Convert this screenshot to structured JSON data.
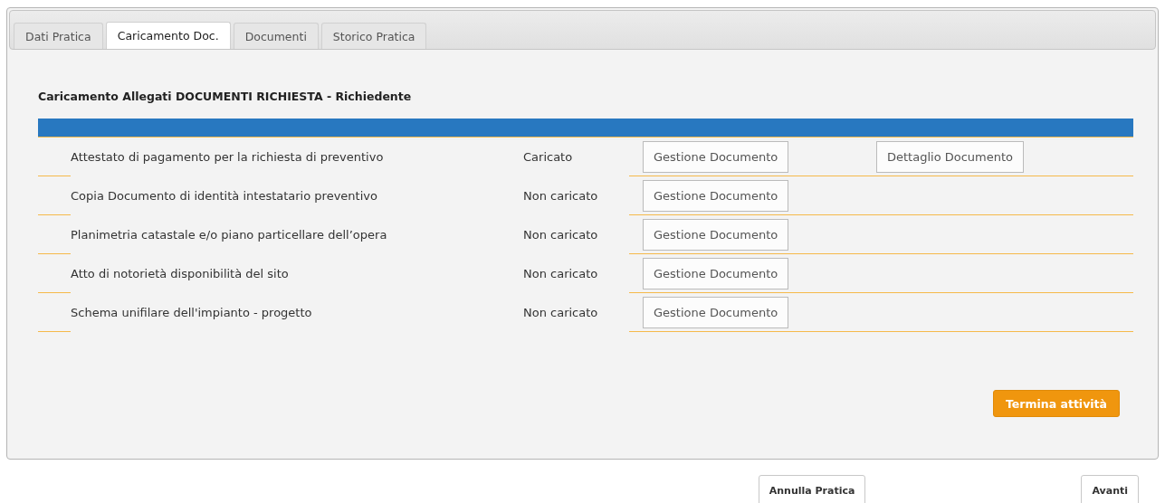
{
  "tabs": [
    {
      "label": "Dati Pratica",
      "selected": false
    },
    {
      "label": "Caricamento Doc.",
      "selected": true
    },
    {
      "label": "Documenti",
      "selected": false
    },
    {
      "label": "Storico Pratica",
      "selected": false
    }
  ],
  "section_title": "Caricamento Allegati DOCUMENTI RICHIESTA - Richiedente",
  "documents": [
    {
      "name": "Attestato di pagamento per la richiesta di preventivo",
      "status": "Caricato",
      "actions": [
        "Gestione Documento",
        "Dettaglio Documento"
      ]
    },
    {
      "name": "Copia Documento di identità intestatario preventivo",
      "status": "Non caricato",
      "actions": [
        "Gestione Documento"
      ]
    },
    {
      "name": "Planimetria catastale e/o piano particellare dell’opera",
      "status": "Non caricato",
      "actions": [
        "Gestione Documento"
      ]
    },
    {
      "name": "Atto di notorietà disponibilità del sito",
      "status": "Non caricato",
      "actions": [
        "Gestione Documento"
      ]
    },
    {
      "name": "Schema unifilare dell'impianto - progetto",
      "status": "Non caricato",
      "actions": [
        "Gestione Documento"
      ]
    }
  ],
  "finish_button": "Termina attività",
  "footer_buttons": [
    "Annulla Pratica",
    "Avanti"
  ]
}
